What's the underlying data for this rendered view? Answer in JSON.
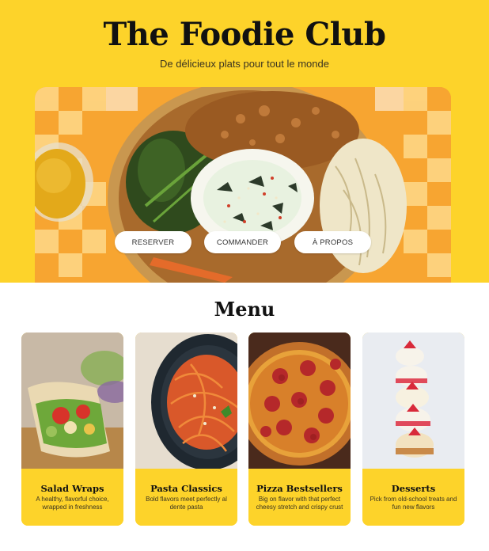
{
  "header": {
    "title": "The Foodie Club",
    "tagline": "De délicieux plats pour tout le monde"
  },
  "hero": {
    "buttons": {
      "reserve": "RESERVER",
      "order": "COMMANDER",
      "about": "À PROPOS"
    }
  },
  "menu": {
    "title": "Menu",
    "items": [
      {
        "name": "Salad Wraps",
        "description": "A healthy, flavorful choice, wrapped in freshness"
      },
      {
        "name": "Pasta Classics",
        "description": "Bold flavors meet perfectly al dente pasta"
      },
      {
        "name": "Pizza Bestsellers",
        "description": "Big on flavor with that perfect cheesy stretch and crispy crust"
      },
      {
        "name": "Desserts",
        "description": "Pick from old-school treats and fun new flavors"
      }
    ]
  },
  "colors": {
    "brand_yellow": "#fdd32a",
    "text_dark": "#111111",
    "button_bg": "#ffffff"
  }
}
